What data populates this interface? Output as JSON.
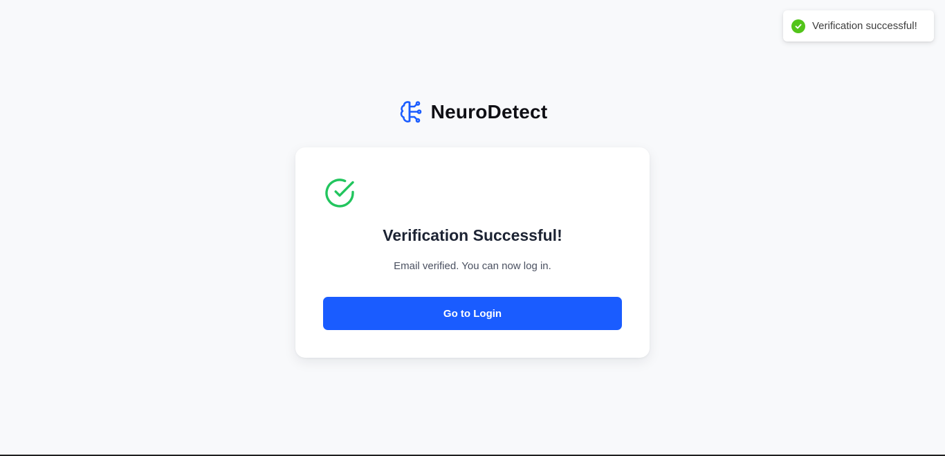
{
  "toast": {
    "message": "Verification successful!",
    "icon": "check-circle-icon",
    "color": "#52c41a"
  },
  "brand": {
    "name": "NeuroDetect",
    "icon": "brain-circuit-icon",
    "color": "#1a5cff"
  },
  "card": {
    "icon": "check-circle-outline-icon",
    "icon_color": "#22c55e",
    "title": "Verification Successful!",
    "message": "Email verified. You can now log in.",
    "button_label": "Go to Login",
    "button_color": "#1a5cff"
  }
}
